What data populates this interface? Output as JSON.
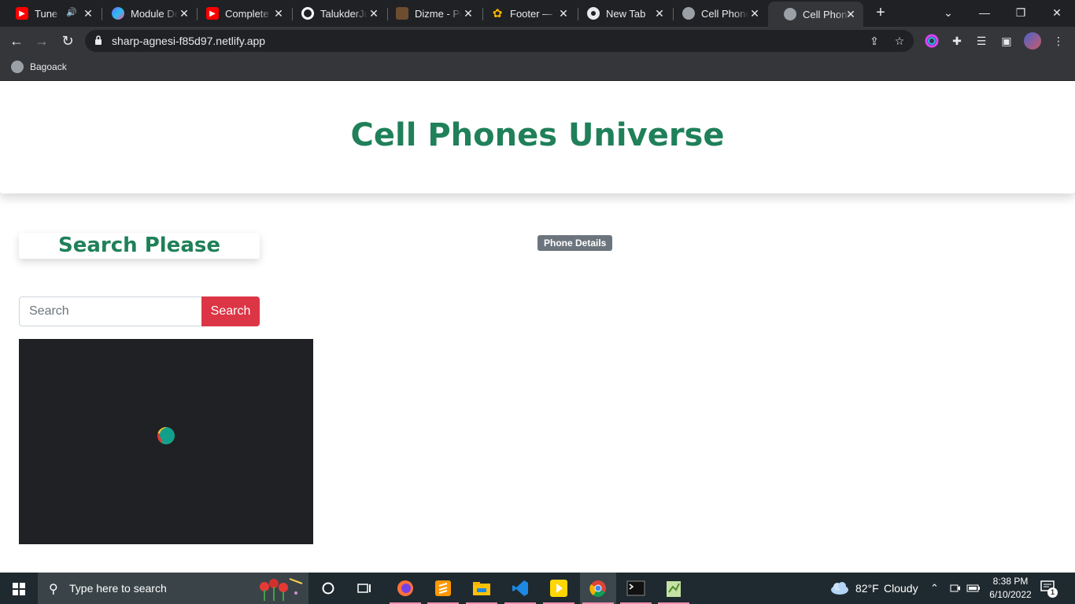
{
  "browser": {
    "tabs": [
      {
        "title": "Tune J",
        "favicon": "youtube-icon",
        "audio": true
      },
      {
        "title": "Module De",
        "favicon": "module-icon"
      },
      {
        "title": "Complete",
        "favicon": "youtube-icon"
      },
      {
        "title": "TalukderJu",
        "favicon": "github-icon"
      },
      {
        "title": "Dizme - Pe",
        "favicon": "dizme-icon"
      },
      {
        "title": "Footer — T",
        "favicon": "flower-icon"
      },
      {
        "title": "New Tab",
        "favicon": "chrome-icon"
      },
      {
        "title": "Cell Phone",
        "favicon": "globe-icon"
      },
      {
        "title": "Cell Phone",
        "favicon": "globe-icon",
        "active": true
      }
    ],
    "url": "sharp-agnesi-f85d97.netlify.app",
    "bookmark": "Bagoack"
  },
  "page": {
    "site_title": "Cell Phones Universe",
    "search_heading": "Search Please",
    "badge": "Phone Details",
    "search_placeholder": "Search",
    "search_button": "Search"
  },
  "taskbar": {
    "search_placeholder": "Type here to search",
    "weather_temp": "82°F",
    "weather_desc": "Cloudy",
    "time": "8:38 PM",
    "date": "6/10/2022",
    "notification_count": "1"
  },
  "colors": {
    "brand_green": "#1f8059",
    "search_red": "#dc3545",
    "badge_gray": "#6c757d",
    "chrome_dark": "#202124"
  }
}
